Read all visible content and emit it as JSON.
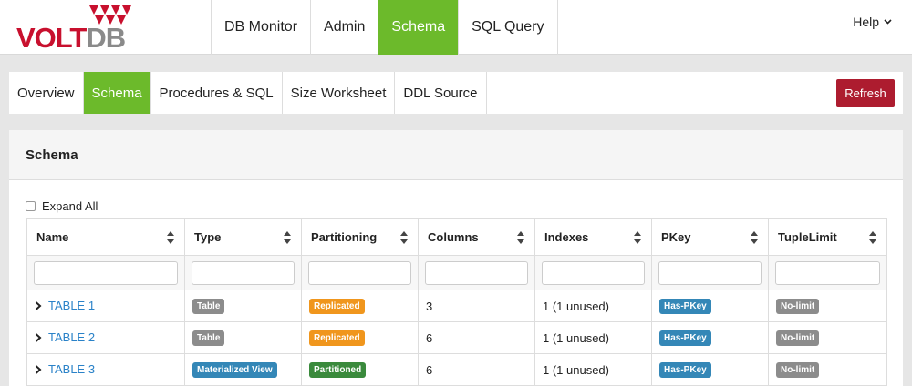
{
  "logo": {
    "volt": "VOLT",
    "db": "DB"
  },
  "mainnav": [
    "DB Monitor",
    "Admin",
    "Schema",
    "SQL Query"
  ],
  "help": "Help",
  "subtabs": [
    "Overview",
    "Schema",
    "Procedures & SQL",
    "Size Worksheet",
    "DDL Source"
  ],
  "refresh": "Refresh",
  "panel": {
    "title": "Schema",
    "expand_all": "Expand All",
    "columns": [
      "Name",
      "Type",
      "Partitioning",
      "Columns",
      "Indexes",
      "PKey",
      "TupleLimit"
    ],
    "rows": [
      {
        "name": "TABLE 1",
        "type": "Table",
        "partitioning": "Replicated",
        "columns": "3",
        "indexes": "1 (1 unused)",
        "pkey": "Has-PKey",
        "tuplelimit": "No-limit"
      },
      {
        "name": "TABLE 2",
        "type": "Table",
        "partitioning": "Replicated",
        "columns": "6",
        "indexes": "1 (1 unused)",
        "pkey": "Has-PKey",
        "tuplelimit": "No-limit"
      },
      {
        "name": "TABLE 3",
        "type": "Materialized View",
        "partitioning": "Partitioned",
        "columns": "6",
        "indexes": "1 (1 unused)",
        "pkey": "Has-PKey",
        "tuplelimit": "No-limit"
      }
    ]
  },
  "colors": {
    "accent": "#6cba2b",
    "refresh": "#ad1c2f",
    "link": "#2a82c8",
    "badge_gray": "#8c8c8c",
    "badge_blue": "#3487b7",
    "badge_orange": "#f0961d",
    "badge_green": "#3a8a3c"
  }
}
